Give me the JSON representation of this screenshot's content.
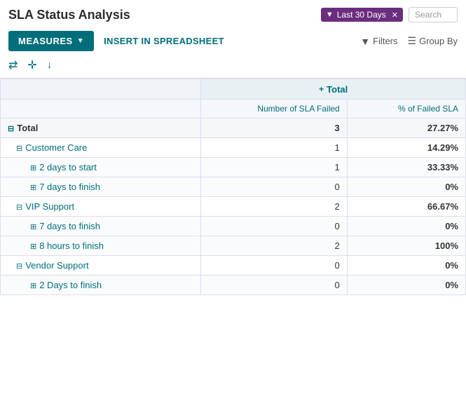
{
  "header": {
    "title": "SLA Status Analysis",
    "filter_tag": "Last 30 Days",
    "search_placeholder": "Search"
  },
  "toolbar": {
    "measures_label": "MEASURES",
    "insert_label": "INSERT IN SPREADSHEET",
    "filters_label": "Filters",
    "group_by_label": "Group By"
  },
  "icons": {
    "swap": "⇄",
    "move": "✛",
    "download": "⬇",
    "funnel": "▼",
    "layers": "≡"
  },
  "table": {
    "group_header": "Total",
    "col1_header": "Number of SLA Failed",
    "col2_header": "% of Failed SLA",
    "rows": [
      {
        "label": "Total",
        "indent": 0,
        "type": "total",
        "expand": "minus",
        "col1": "3",
        "col2": "27.27%"
      },
      {
        "label": "Customer Care",
        "indent": 1,
        "type": "group",
        "expand": "minus",
        "col1": "1",
        "col2": "14.29%"
      },
      {
        "label": "2 days to start",
        "indent": 2,
        "type": "sub",
        "expand": "plus",
        "col1": "1",
        "col2": "33.33%"
      },
      {
        "label": "7 days to finish",
        "indent": 2,
        "type": "sub",
        "expand": "plus",
        "col1": "0",
        "col2": "0%"
      },
      {
        "label": "VIP Support",
        "indent": 1,
        "type": "group",
        "expand": "minus",
        "col1": "2",
        "col2": "66.67%"
      },
      {
        "label": "7 days to finish",
        "indent": 2,
        "type": "sub",
        "expand": "plus",
        "col1": "0",
        "col2": "0%"
      },
      {
        "label": "8 hours to finish",
        "indent": 2,
        "type": "sub",
        "expand": "plus",
        "col1": "2",
        "col2": "100%"
      },
      {
        "label": "Vendor Support",
        "indent": 1,
        "type": "group",
        "expand": "minus",
        "col1": "0",
        "col2": "0%"
      },
      {
        "label": "2 Days to finish",
        "indent": 2,
        "type": "sub",
        "expand": "plus",
        "col1": "0",
        "col2": "0%"
      }
    ]
  }
}
